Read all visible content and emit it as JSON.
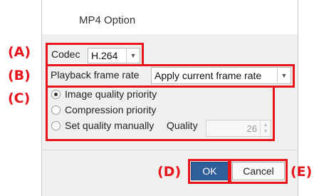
{
  "dialog": {
    "title": "MP4 Option"
  },
  "codec": {
    "label": "Codec",
    "value": "H.264"
  },
  "frame_rate": {
    "label": "Playback frame rate",
    "value": "Apply current frame rate"
  },
  "quality_mode": {
    "options": [
      {
        "label": "Image quality priority",
        "selected": true
      },
      {
        "label": "Compression priority",
        "selected": false
      },
      {
        "label": "Set quality manually",
        "selected": false
      }
    ],
    "quality_label": "Quality",
    "quality_value": "26"
  },
  "buttons": {
    "ok": "OK",
    "cancel": "Cancel"
  },
  "annotations": {
    "a": "(A)",
    "b": "(B)",
    "c": "(C)",
    "d": "(D)",
    "e": "(E)",
    "color": "#e8141c"
  }
}
